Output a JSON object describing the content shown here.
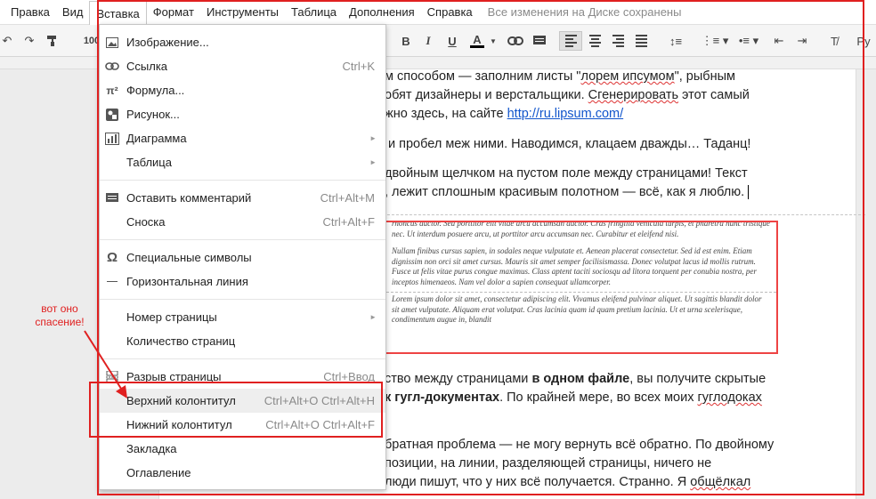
{
  "menubar": {
    "items": [
      "Правка",
      "Вид",
      "Вставка",
      "Формат",
      "Инструменты",
      "Таблица",
      "Дополнения",
      "Справка"
    ],
    "active_index": 2,
    "save_status": "Все изменения на Диске сохранены"
  },
  "toolbar": {
    "zoom": "100",
    "bold": "B",
    "italic": "I",
    "underline": "U",
    "text_color": "A",
    "text_color_underline": "#000000",
    "lang_hint": "Ру"
  },
  "insert_menu": {
    "items": [
      {
        "label": "Изображение...",
        "shortcut": "",
        "icon": "image-icon",
        "submenu": false
      },
      {
        "label": "Ссылка",
        "shortcut": "Ctrl+K",
        "icon": "link-icon",
        "submenu": false
      },
      {
        "label": "Формула...",
        "shortcut": "",
        "icon": "pi-icon",
        "submenu": false
      },
      {
        "label": "Рисунок...",
        "shortcut": "",
        "icon": "drawing-icon",
        "submenu": false
      },
      {
        "label": "Диаграмма",
        "shortcut": "",
        "icon": "chart-icon",
        "submenu": true
      },
      {
        "label": "Таблица",
        "shortcut": "",
        "icon": "",
        "submenu": true
      },
      {
        "label": "Оставить комментарий",
        "shortcut": "Ctrl+Alt+M",
        "icon": "comment-icon",
        "submenu": false
      },
      {
        "label": "Сноска",
        "shortcut": "Ctrl+Alt+F",
        "icon": "",
        "submenu": false
      },
      {
        "label": "Специальные символы",
        "shortcut": "",
        "icon": "omega-icon",
        "submenu": false
      },
      {
        "label": "Горизонтальная линия",
        "shortcut": "",
        "icon": "hr-icon",
        "submenu": false
      },
      {
        "label": "Номер страницы",
        "shortcut": "",
        "icon": "",
        "submenu": true
      },
      {
        "label": "Количество страниц",
        "shortcut": "",
        "icon": "",
        "submenu": false
      },
      {
        "label": "Разрыв страницы",
        "shortcut": "Ctrl+Ввод",
        "icon": "page-break-icon",
        "submenu": false
      },
      {
        "label": "Верхний колонтитул",
        "shortcut": "Ctrl+Alt+O Ctrl+Alt+H",
        "icon": "",
        "submenu": false
      },
      {
        "label": "Нижний колонтитул",
        "shortcut": "Ctrl+Alt+O Ctrl+Alt+F",
        "icon": "",
        "submenu": false
      },
      {
        "label": "Закладка",
        "shortcut": "",
        "icon": "",
        "submenu": false
      },
      {
        "label": "Оглавление",
        "shortcut": "",
        "icon": "",
        "submenu": false
      }
    ]
  },
  "document": {
    "p1_l1_a": "м способом — заполним листы \"",
    "p1_l1_b": "лорем ипсумом",
    "p1_l1_c": "\", рыбным",
    "p1_l2_a": "обят дизайнеры и верстальщики. ",
    "p1_l2_b": "Сгенерировать",
    "p1_l2_c": " этот самый",
    "p1_l3_a": "жно здесь, на сайте ",
    "p1_l3_link": "http://ru.lipsum.com/",
    "p2": "и пробел меж ними. Наводимся, клацаем дважды… Таданц!",
    "p3_l1": "двойным щелчком на пустом поле между страницами! Текст",
    "p3_l2": ", лежит сплошным красивым полотном — всё, как я люблю.",
    "p4_l1_a": "ство между страницами ",
    "p4_l1_b": "в одном файле",
    "p4_l1_c": ", вы получите скрытые",
    "p4_l2_a": "к гугл-документах",
    "p4_l2_b": ". По крайней мере, во всех моих ",
    "p4_l2_c": "гуглодоках",
    "p5_l1": "братная проблема — не могу вернуть всё обратно. По двойному",
    "p5_l2": "позиции, на линии, разделяющей страницы, ничего не",
    "p5_l3_a": "люди пишут, что у них всё получается. Странно. Я ",
    "p5_l3_b": "общёлкал"
  },
  "embedded_image": {
    "para1": "rhoncus auctor. Sed porttitor elit vitae arcu accumsan auctor. Cras fringilla vehicula turpis, et pharetra nunc tristique nec. Ut interdum posuere arcu, ut porttitor arcu accumsan nec. Curabitur et eleifend nisi.",
    "para2": "Nullam finibus cursus sapien, in sodales neque vulputate et. Aenean placerat consectetur. Sed id est enim. Etiam dignissim non orci sit amet cursus. Mauris sit amet semper facilisismassa. Donec volutpat lacus id mollis rutrum. Fusce ut felis vitae purus congue maximus. Class aptent taciti sociosqu ad litora torquent per conubia nostra, per inceptos himenaeos. Nam vel dolor a sapien consequat ullamcorper.",
    "para3": "Lorem ipsum dolor sit amet, consectetur adipiscing elit. Vivamus eleifend pulvinar aliquet. Ut sagittis blandit dolor sit amet vulputate. Aliquam erat volutpat. Cras lacinia quam id quam pretium lacinia. Ut et urna scelerisque, condimentum augue in, blandit"
  },
  "annotation": {
    "text": "вот оно спасение!",
    "color": "#e02020"
  }
}
